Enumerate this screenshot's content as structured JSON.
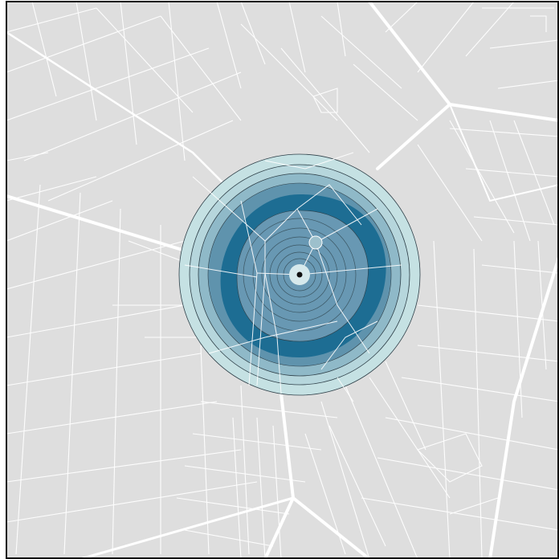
{
  "map": {
    "background": "#dedede",
    "frame_color": "#111111",
    "colors": {
      "road_major": "#ffffff",
      "road_minor": "#ffffff",
      "ring_outer": "#c5e1e3",
      "ring_mid": "#a9ccd3",
      "ring_steel": "#5f93ad",
      "ring_dark": "#1d6d93",
      "ring_inner": "#6898b3",
      "center_halo": "#d6e9ec",
      "center_dot": "#111111",
      "ring_stroke": "#2e3f48"
    },
    "marker": {
      "name": "location-marker",
      "label": ""
    }
  }
}
